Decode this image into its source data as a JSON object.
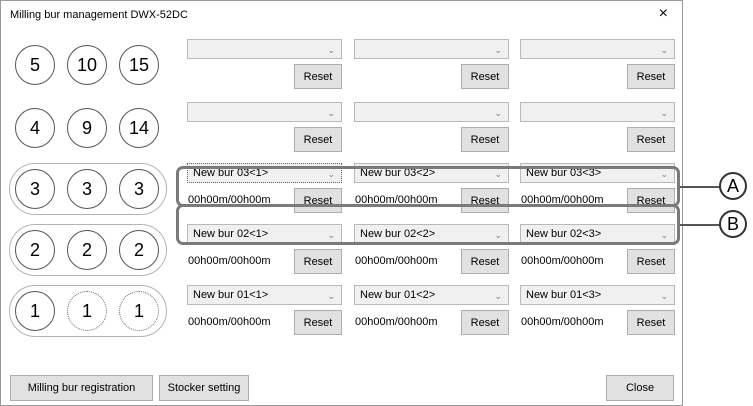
{
  "window": {
    "title": "Milling bur management DWX-52DC",
    "close_glyph": "×"
  },
  "rows": [
    {
      "circles": [
        "5",
        "10",
        "15"
      ],
      "grouped": false,
      "dotted": [
        false,
        false,
        false
      ],
      "slots": [
        {
          "value": "",
          "time": "",
          "reset": "Reset"
        },
        {
          "value": "",
          "time": "",
          "reset": "Reset"
        },
        {
          "value": "",
          "time": "",
          "reset": "Reset"
        }
      ]
    },
    {
      "circles": [
        "4",
        "9",
        "14"
      ],
      "grouped": false,
      "dotted": [
        false,
        false,
        false
      ],
      "slots": [
        {
          "value": "",
          "time": "",
          "reset": "Reset"
        },
        {
          "value": "",
          "time": "",
          "reset": "Reset"
        },
        {
          "value": "",
          "time": "",
          "reset": "Reset"
        }
      ]
    },
    {
      "circles": [
        "3",
        "3",
        "3"
      ],
      "grouped": true,
      "dotted": [
        false,
        false,
        false
      ],
      "slots": [
        {
          "value": "New bur 03<1>",
          "time": "00h00m/00h00m",
          "reset": "Reset"
        },
        {
          "value": "New bur 03<2>",
          "time": "00h00m/00h00m",
          "reset": "Reset"
        },
        {
          "value": "New bur 03<3>",
          "time": "00h00m/00h00m",
          "reset": "Reset"
        }
      ]
    },
    {
      "circles": [
        "2",
        "2",
        "2"
      ],
      "grouped": true,
      "dotted": [
        false,
        false,
        false
      ],
      "slots": [
        {
          "value": "New bur 02<1>",
          "time": "00h00m/00h00m",
          "reset": "Reset"
        },
        {
          "value": "New bur 02<2>",
          "time": "00h00m/00h00m",
          "reset": "Reset"
        },
        {
          "value": "New bur 02<3>",
          "time": "00h00m/00h00m",
          "reset": "Reset"
        }
      ]
    },
    {
      "circles": [
        "1",
        "1",
        "1"
      ],
      "grouped": true,
      "dotted": [
        false,
        true,
        true
      ],
      "slots": [
        {
          "value": "New bur 01<1>",
          "time": "00h00m/00h00m",
          "reset": "Reset"
        },
        {
          "value": "New bur 01<2>",
          "time": "00h00m/00h00m",
          "reset": "Reset"
        },
        {
          "value": "New bur 01<3>",
          "time": "00h00m/00h00m",
          "reset": "Reset"
        }
      ]
    }
  ],
  "footer": {
    "registration": "Milling bur registration",
    "stocker": "Stocker setting",
    "close": "Close"
  },
  "callouts": [
    "A",
    "B"
  ],
  "icons": {
    "dropdown": "chevron-down-icon",
    "close": "close-icon"
  }
}
